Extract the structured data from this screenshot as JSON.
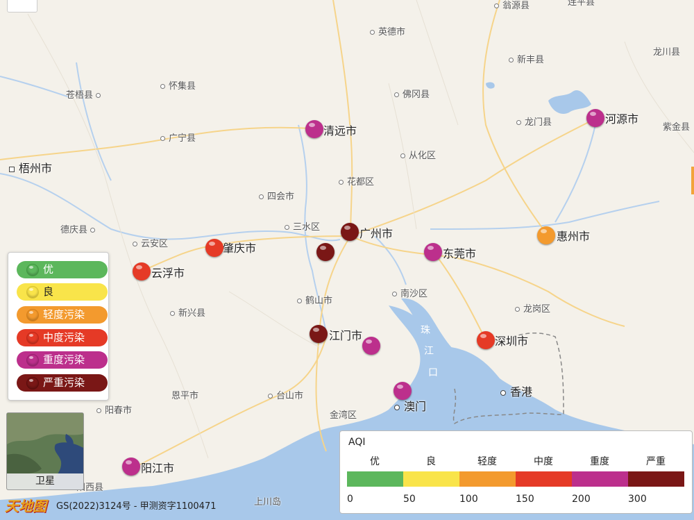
{
  "places": [
    {
      "name": "苍梧县"
    },
    {
      "name": "怀集县"
    },
    {
      "name": "广宁县"
    },
    {
      "name": "四会市"
    },
    {
      "name": "三水区"
    },
    {
      "name": "德庆县"
    },
    {
      "name": "云安区"
    },
    {
      "name": "新兴县"
    },
    {
      "name": "鹤山市"
    },
    {
      "name": "恩平市"
    },
    {
      "name": "台山市"
    },
    {
      "name": "阳春市"
    },
    {
      "name": "金湾区"
    },
    {
      "name": "阳西县"
    },
    {
      "name": "英德市"
    },
    {
      "name": "佛冈县"
    },
    {
      "name": "从化区"
    },
    {
      "name": "花都区"
    },
    {
      "name": "南沙区"
    },
    {
      "name": "龙岗区"
    },
    {
      "name": "新丰县"
    },
    {
      "name": "龙门县"
    },
    {
      "name": "翁源县"
    },
    {
      "name": "连平县"
    },
    {
      "name": "龙川县"
    },
    {
      "name": "紫金县"
    },
    {
      "name": "上川岛"
    },
    {
      "name": "香港"
    }
  ],
  "cities": [
    {
      "name": "梧州市",
      "level": "none"
    },
    {
      "name": "清远市",
      "level": "heavy"
    },
    {
      "name": "河源市",
      "level": "heavy"
    },
    {
      "name": "肇庆市",
      "level": "moderate"
    },
    {
      "name": "云浮市",
      "level": "moderate"
    },
    {
      "name": "广州市",
      "level": "severe"
    },
    {
      "name": "东莞市",
      "level": "heavy"
    },
    {
      "name": "惠州市",
      "level": "light"
    },
    {
      "name": "江门市",
      "level": "severe"
    },
    {
      "name": "深圳市",
      "level": "moderate"
    },
    {
      "name": "澳门",
      "level": "heavy"
    },
    {
      "name": "阳江市",
      "level": "heavy"
    }
  ],
  "unlabeled_markers": [
    {
      "level": "severe"
    },
    {
      "level": "heavy"
    }
  ],
  "river_label": "珠江口",
  "legend": {
    "items": [
      {
        "label": "优",
        "color": "#5cb75c"
      },
      {
        "label": "良",
        "color": "#f9e44a"
      },
      {
        "label": "轻度污染",
        "color": "#f39a2e"
      },
      {
        "label": "中度污染",
        "color": "#e53a26"
      },
      {
        "label": "重度污染",
        "color": "#bc2f8c"
      },
      {
        "label": "严重污染",
        "color": "#7a1716"
      }
    ]
  },
  "aqi_scale": {
    "title": "AQI",
    "levels": [
      {
        "label": "优",
        "color": "#5cb75c"
      },
      {
        "label": "良",
        "color": "#f9e44a"
      },
      {
        "label": "轻度",
        "color": "#f39a2e"
      },
      {
        "label": "中度",
        "color": "#e53a26"
      },
      {
        "label": "重度",
        "color": "#bc2f8c"
      },
      {
        "label": "严重",
        "color": "#7a1716"
      }
    ],
    "ticks": [
      "0",
      "50",
      "100",
      "150",
      "200",
      "300"
    ]
  },
  "satellite_label": "卫星",
  "brand": "天地图",
  "copyright": "GS(2022)3124号 - 甲测资字1100471",
  "colors": {
    "land": "#f4f1ea",
    "water": "#a8c8ea",
    "road": "#f6d48a"
  }
}
